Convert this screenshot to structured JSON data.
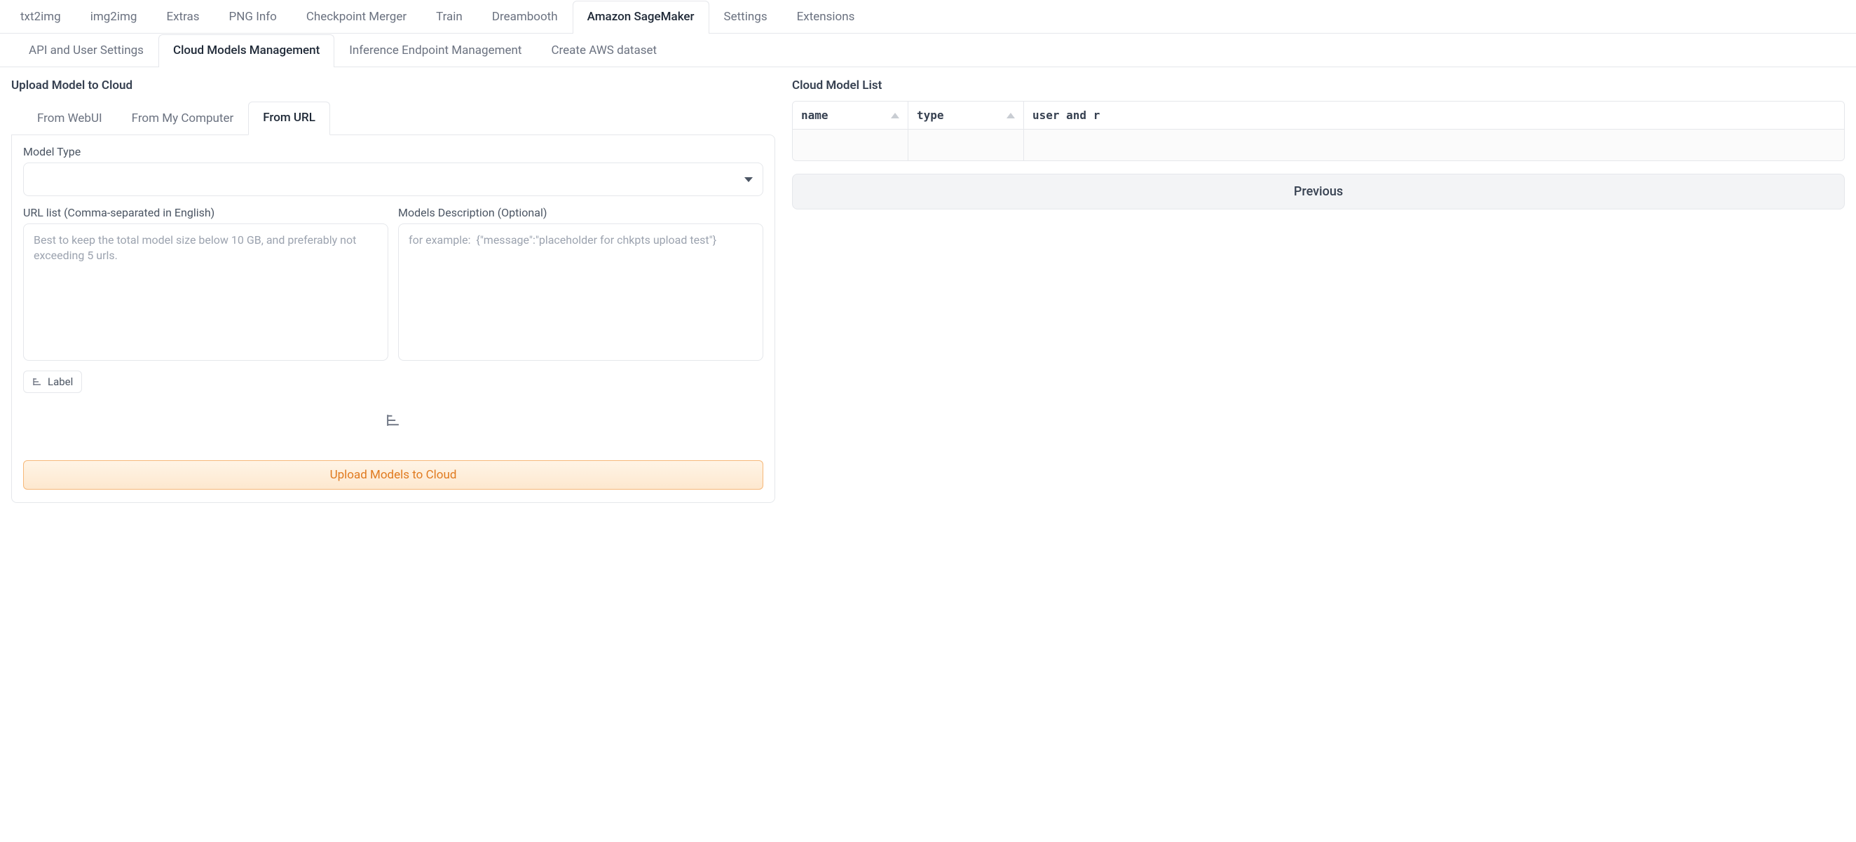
{
  "tabs_primary": [
    {
      "label": "txt2img",
      "active": false
    },
    {
      "label": "img2img",
      "active": false
    },
    {
      "label": "Extras",
      "active": false
    },
    {
      "label": "PNG Info",
      "active": false
    },
    {
      "label": "Checkpoint Merger",
      "active": false
    },
    {
      "label": "Train",
      "active": false
    },
    {
      "label": "Dreambooth",
      "active": false
    },
    {
      "label": "Amazon SageMaker",
      "active": true
    },
    {
      "label": "Settings",
      "active": false
    },
    {
      "label": "Extensions",
      "active": false
    }
  ],
  "tabs_sagemaker": [
    {
      "label": "API and User Settings",
      "active": false
    },
    {
      "label": "Cloud Models Management",
      "active": true
    },
    {
      "label": "Inference Endpoint Management",
      "active": false
    },
    {
      "label": "Create AWS dataset",
      "active": false
    }
  ],
  "upload_section_title": "Upload Model to Cloud",
  "tabs_upload_source": [
    {
      "label": "From WebUI",
      "active": false
    },
    {
      "label": "From My Computer",
      "active": false
    },
    {
      "label": "From URL",
      "active": true
    }
  ],
  "model_type_label": "Model Type",
  "model_type_value": "",
  "url_list_label": "URL list (Comma-separated in English)",
  "url_list_placeholder": "Best to keep the total model size below 10 GB, and preferably not exceeding 5 urls.",
  "models_desc_label": "Models Description (Optional)",
  "models_desc_placeholder": "for example:  {\"message\":\"placeholder for chkpts upload test\"}",
  "label_chip_text": "Label",
  "upload_button_label": "Upload Models to Cloud",
  "cloud_model_list_title": "Cloud Model List",
  "table_headers": {
    "name": "name",
    "type": "type",
    "user": "user and r"
  },
  "previous_button_label": "Previous"
}
